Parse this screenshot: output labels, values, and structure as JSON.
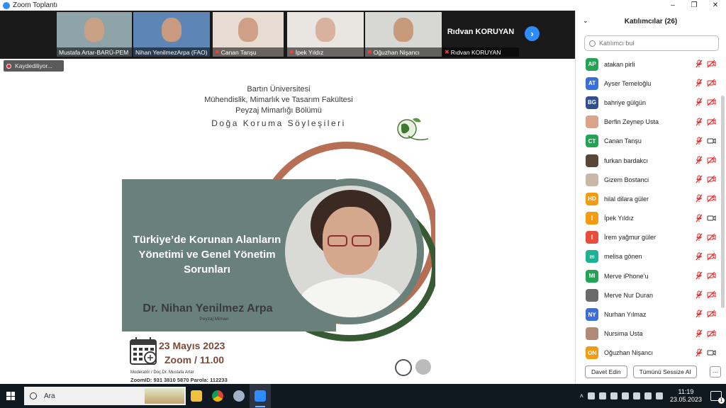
{
  "window": {
    "title": "Zoom Toplantı",
    "controls": [
      "–",
      "❐",
      "✕"
    ]
  },
  "gallery": {
    "participants": [
      {
        "name": "Mustafa Artar-BARÜ-PEM",
        "muted": false,
        "skin": "#c9a184",
        "bg": "#8fa4a8"
      },
      {
        "name": "Nihan YenilmezArpa (FAO)",
        "muted": false,
        "skin": "#c99a80",
        "bg": "#5d86b7"
      },
      {
        "name": "Canan Tanşu",
        "muted": true,
        "skin": "#cf9f86",
        "bg": "#e6dcd2"
      },
      {
        "name": "İpek Yıldız",
        "muted": true,
        "skin": "#d8b29e",
        "bg": "#e9e6e2"
      },
      {
        "name": "Oğuzhan Nişancı",
        "muted": true,
        "skin": "#c79a7c",
        "bg": "#d7d7d4"
      },
      {
        "name": "Rıdvan KORUYAN",
        "muted": true,
        "bigname": "Rıdvan KORUYAN"
      }
    ],
    "next_icon": "chevron-right-icon"
  },
  "recording": {
    "label": "Kaydediliyor..."
  },
  "poster": {
    "university": "Bartın Üniversitesi",
    "faculty": "Mühendislik, Mimarlık ve Tasarım Fakültesi",
    "department": "Peyzaj Mimarlığı Bölümü",
    "series": "Doğa Koruma Söyleşileri",
    "talk_title": [
      "Türkiye’de Korunan Alanların",
      "Yönetimi ve Genel Yönetim",
      "Sorunları"
    ],
    "speaker": "Dr. Nihan Yenilmez Arpa",
    "speaker_role": "Peyzaj Mimarı",
    "date": "23 Mayıs 2023",
    "time": "Zoom / 11.00",
    "moderator": "Moderatör / Doç.Dr. Mustafa Artar",
    "zoom_id": "ZoomID: 931 3810 5870 Parola: 112233",
    "colors": {
      "band": "#6a807b",
      "arc": "#b66f55",
      "green": "#365a34",
      "date": "#7a4a3a"
    }
  },
  "participants_panel": {
    "title": "Katılımcılar (26)",
    "search_placeholder": "Katılımcı bul",
    "list": [
      {
        "initials": "AP",
        "name": "atakan pirli",
        "color": "#23a455",
        "mic": "muted",
        "cam": "off"
      },
      {
        "initials": "AT",
        "name": "Ayser Temeloğlu",
        "color": "#3a6fd8",
        "mic": "muted",
        "cam": "off"
      },
      {
        "initials": "BG",
        "name": "bahriye gülgün",
        "color": "#2f4f8f",
        "mic": "muted",
        "cam": "off"
      },
      {
        "initials": "",
        "name": "Berfin Zeynep Usta",
        "color": "#d9a58a",
        "mic": "muted",
        "cam": "off",
        "photo": true
      },
      {
        "initials": "CT",
        "name": "Canan Tanşu",
        "color": "#23a455",
        "mic": "muted",
        "cam": "on"
      },
      {
        "initials": "",
        "name": "furkan bardakcı",
        "color": "#5a4636",
        "mic": "muted",
        "cam": "off",
        "photo": true
      },
      {
        "initials": "",
        "name": "Gizem Bostanci",
        "color": "#c9b8a8",
        "mic": "muted",
        "cam": "off",
        "photo": true
      },
      {
        "initials": "HD",
        "name": "hilal dilara güler",
        "color": "#f39c12",
        "mic": "muted",
        "cam": "off"
      },
      {
        "initials": "İ",
        "name": "İpek Yıldız",
        "color": "#f39c12",
        "mic": "muted",
        "cam": "on"
      },
      {
        "initials": "İ",
        "name": "İrem yağmur güler",
        "color": "#e74c3c",
        "mic": "muted",
        "cam": "off"
      },
      {
        "initials": "m",
        "name": "melisa gönen",
        "color": "#1ab394",
        "mic": "muted",
        "cam": "off"
      },
      {
        "initials": "MI",
        "name": "Merve iPhone’u",
        "color": "#23a455",
        "mic": "muted",
        "cam": "off"
      },
      {
        "initials": "",
        "name": "Merve Nur Duran",
        "color": "#6b6b6b",
        "mic": "muted",
        "cam": "off",
        "photo": true
      },
      {
        "initials": "NY",
        "name": "Nurhan Yılmaz",
        "color": "#3a6fd8",
        "mic": "muted",
        "cam": "off"
      },
      {
        "initials": "",
        "name": "Nursima Usta",
        "color": "#b08a76",
        "mic": "muted",
        "cam": "off",
        "photo": true
      },
      {
        "initials": "ON",
        "name": "Oğuzhan Nişancı",
        "color": "#f39c12",
        "mic": "muted",
        "cam": "on"
      }
    ],
    "invite_label": "Davet Edin",
    "mute_all_label": "Tümünü Sessize Al",
    "more_label": "···"
  },
  "taskbar": {
    "search_label": "Ara",
    "apps": [
      "file-explorer-icon",
      "chrome-icon",
      "app-icon",
      "zoom-icon"
    ],
    "time": "11:19",
    "date": "23.05.2023",
    "notifications": "1"
  }
}
